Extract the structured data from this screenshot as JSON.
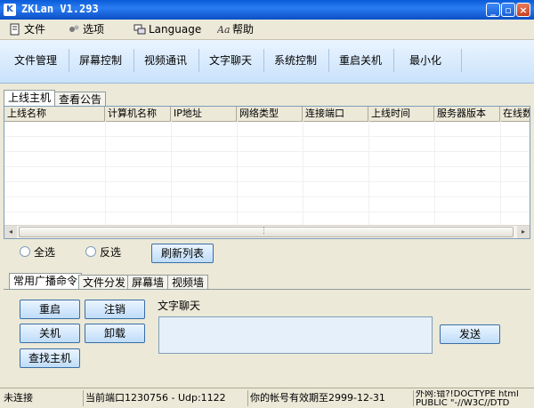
{
  "window": {
    "title": "ZKLan V1.293",
    "icon_letter": "K",
    "min_glyph": "_",
    "max_glyph": "▫",
    "close_glyph": "×"
  },
  "menu": [
    {
      "label": "文件",
      "icon": "file-icon"
    },
    {
      "label": "选项",
      "icon": "options-icon"
    },
    {
      "label": "Language",
      "icon": "language-icon"
    },
    {
      "label": "帮助",
      "icon": "help-icon"
    }
  ],
  "toolbar": [
    "文件管理",
    "屏幕控制",
    "视频通讯",
    "文字聊天",
    "系统控制",
    "重启关机",
    "最小化"
  ],
  "top_tabs": [
    "上线主机",
    "查看公告"
  ],
  "table": {
    "columns": [
      "上线名称",
      "计算机名称",
      "IP地址",
      "网络类型",
      "连接端口",
      "上线时间",
      "服务器版本",
      "在线数"
    ]
  },
  "scroll": {
    "left": "◂",
    "grip": "⋮",
    "right": "▸"
  },
  "select": {
    "select_all": "全选",
    "invert": "反选",
    "refresh": "刷新列表"
  },
  "bottom_tabs": [
    "常用广播命令",
    "文件分发",
    "屏幕墙",
    "视频墙"
  ],
  "commands": {
    "restart": "重启",
    "logout": "注销",
    "shutdown": "关机",
    "uninstall": "卸载",
    "find_host": "查找主机"
  },
  "chat": {
    "label": "文字聊天",
    "send": "发送"
  },
  "status": {
    "connection": "未连接",
    "port": "当前端口1230756 - Udp:1122",
    "expiry": "你的帐号有效期至2999-12-31",
    "ip": "外网:错?!DOCTYPE html PUBLIC \"-//W3C//DTD"
  }
}
